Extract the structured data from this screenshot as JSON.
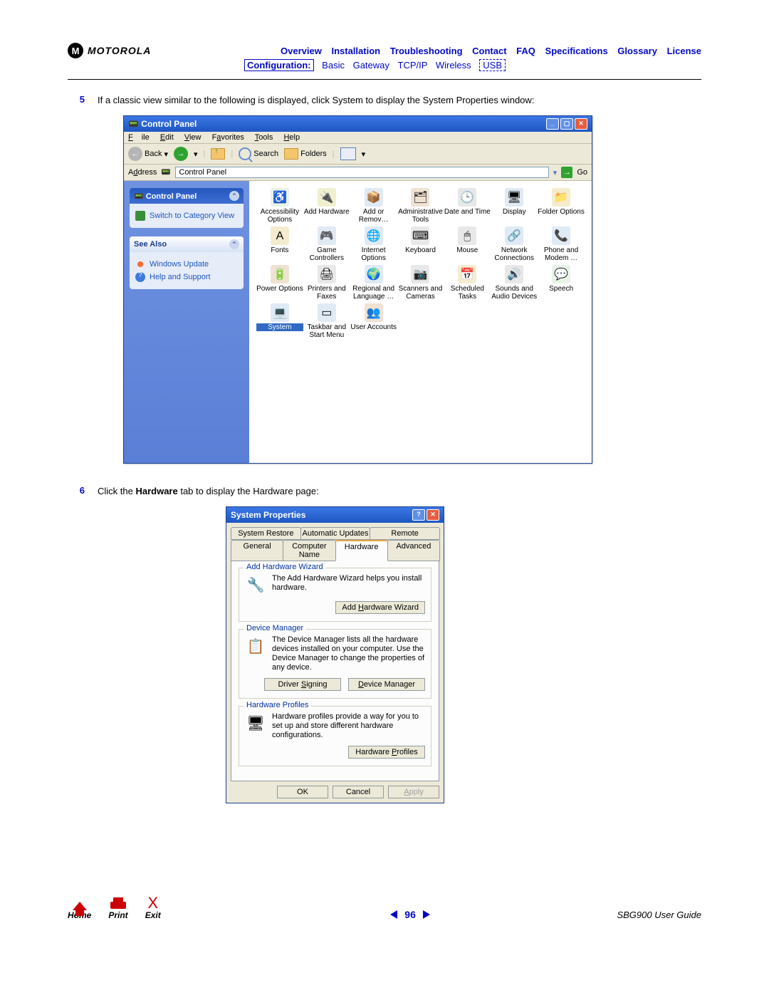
{
  "header": {
    "logo_text": "MOTOROLA",
    "links": [
      "Overview",
      "Installation",
      "Troubleshooting",
      "Contact",
      "FAQ",
      "Specifications",
      "Glossary",
      "License"
    ],
    "config_label": "Configuration:",
    "sub_links": [
      "Basic",
      "Gateway",
      "TCP/IP",
      "Wireless"
    ],
    "usb_label": "USB"
  },
  "steps": {
    "s5_num": "5",
    "s5_text": "If a classic view similar to the following is displayed, click System to display the System Properties window:",
    "s6_num": "6",
    "s6_pre": "Click the ",
    "s6_bold": "Hardware",
    "s6_post": " tab to display the Hardware page:"
  },
  "cp": {
    "title": "Control Panel",
    "menu": {
      "file": "File",
      "edit": "Edit",
      "view": "View",
      "fav": "Favorites",
      "tools": "Tools",
      "help": "Help"
    },
    "toolbar": {
      "back": "Back",
      "search": "Search",
      "folders": "Folders"
    },
    "address_label": "Address",
    "address_value": "Control Panel",
    "go": "Go",
    "sidebar": {
      "panel1_title": "Control Panel",
      "switch_view": "Switch to Category View",
      "panel2_title": "See Also",
      "windows_update": "Windows Update",
      "help_support": "Help and Support"
    },
    "icons": [
      {
        "label": "Accessibility Options",
        "glyph": "♿",
        "bg": "#e7f3e7"
      },
      {
        "label": "Add Hardware",
        "glyph": "🔌",
        "bg": "#f0f0d0"
      },
      {
        "label": "Add or Remov…",
        "glyph": "📦",
        "bg": "#e0eaf5"
      },
      {
        "label": "Administrative Tools",
        "glyph": "🗂",
        "bg": "#f0e2d2"
      },
      {
        "label": "Date and Time",
        "glyph": "🕒",
        "bg": "#e8e8e8"
      },
      {
        "label": "Display",
        "glyph": "🖥",
        "bg": "#e0eaf5"
      },
      {
        "label": "Folder Options",
        "glyph": "📁",
        "bg": "#f5ecd0"
      },
      {
        "label": "Fonts",
        "glyph": "A",
        "bg": "#f5ecd0"
      },
      {
        "label": "Game Controllers",
        "glyph": "🎮",
        "bg": "#e0eaf5"
      },
      {
        "label": "Internet Options",
        "glyph": "🌐",
        "bg": "#e0eaf5"
      },
      {
        "label": "Keyboard",
        "glyph": "⌨",
        "bg": "#e8e8e8"
      },
      {
        "label": "Mouse",
        "glyph": "🖱",
        "bg": "#e8e8e8"
      },
      {
        "label": "Network Connections",
        "glyph": "🔗",
        "bg": "#e0eaf5"
      },
      {
        "label": "Phone and Modem …",
        "glyph": "📞",
        "bg": "#e0eaf5"
      },
      {
        "label": "Power Options",
        "glyph": "🔋",
        "bg": "#f0e2d2"
      },
      {
        "label": "Printers and Faxes",
        "glyph": "🖨",
        "bg": "#e8e8e8"
      },
      {
        "label": "Regional and Language …",
        "glyph": "🌍",
        "bg": "#e0eaf5"
      },
      {
        "label": "Scanners and Cameras",
        "glyph": "📷",
        "bg": "#e8e8e8"
      },
      {
        "label": "Scheduled Tasks",
        "glyph": "📅",
        "bg": "#f5ecd0"
      },
      {
        "label": "Sounds and Audio Devices",
        "glyph": "🔊",
        "bg": "#e8e8e8"
      },
      {
        "label": "Speech",
        "glyph": "💬",
        "bg": "#e7f3e7"
      },
      {
        "label": "System",
        "glyph": "💻",
        "bg": "#e0eaf5",
        "selected": true
      },
      {
        "label": "Taskbar and Start Menu",
        "glyph": "▭",
        "bg": "#e0eaf5"
      },
      {
        "label": "User Accounts",
        "glyph": "👥",
        "bg": "#f0e2d2"
      }
    ]
  },
  "sp": {
    "title": "System Properties",
    "tabs_row1": [
      "System Restore",
      "Automatic Updates",
      "Remote"
    ],
    "tabs_row2": [
      "General",
      "Computer Name",
      "Hardware",
      "Advanced"
    ],
    "active_tab": "Hardware",
    "g1": {
      "title": "Add Hardware Wizard",
      "text": "The Add Hardware Wizard helps you install hardware.",
      "btn": "Add Hardware Wizard"
    },
    "g2": {
      "title": "Device Manager",
      "text": "The Device Manager lists all the hardware devices installed on your computer. Use the Device Manager to change the properties of any device.",
      "btn1": "Driver Signing",
      "btn2": "Device Manager"
    },
    "g3": {
      "title": "Hardware Profiles",
      "text": "Hardware profiles provide a way for you to set up and store different hardware configurations.",
      "btn": "Hardware Profiles"
    },
    "ok": "OK",
    "cancel": "Cancel",
    "apply": "Apply"
  },
  "footer": {
    "home": "Home",
    "print": "Print",
    "exit": "Exit",
    "page": "96",
    "guide": "SBG900 User Guide"
  }
}
